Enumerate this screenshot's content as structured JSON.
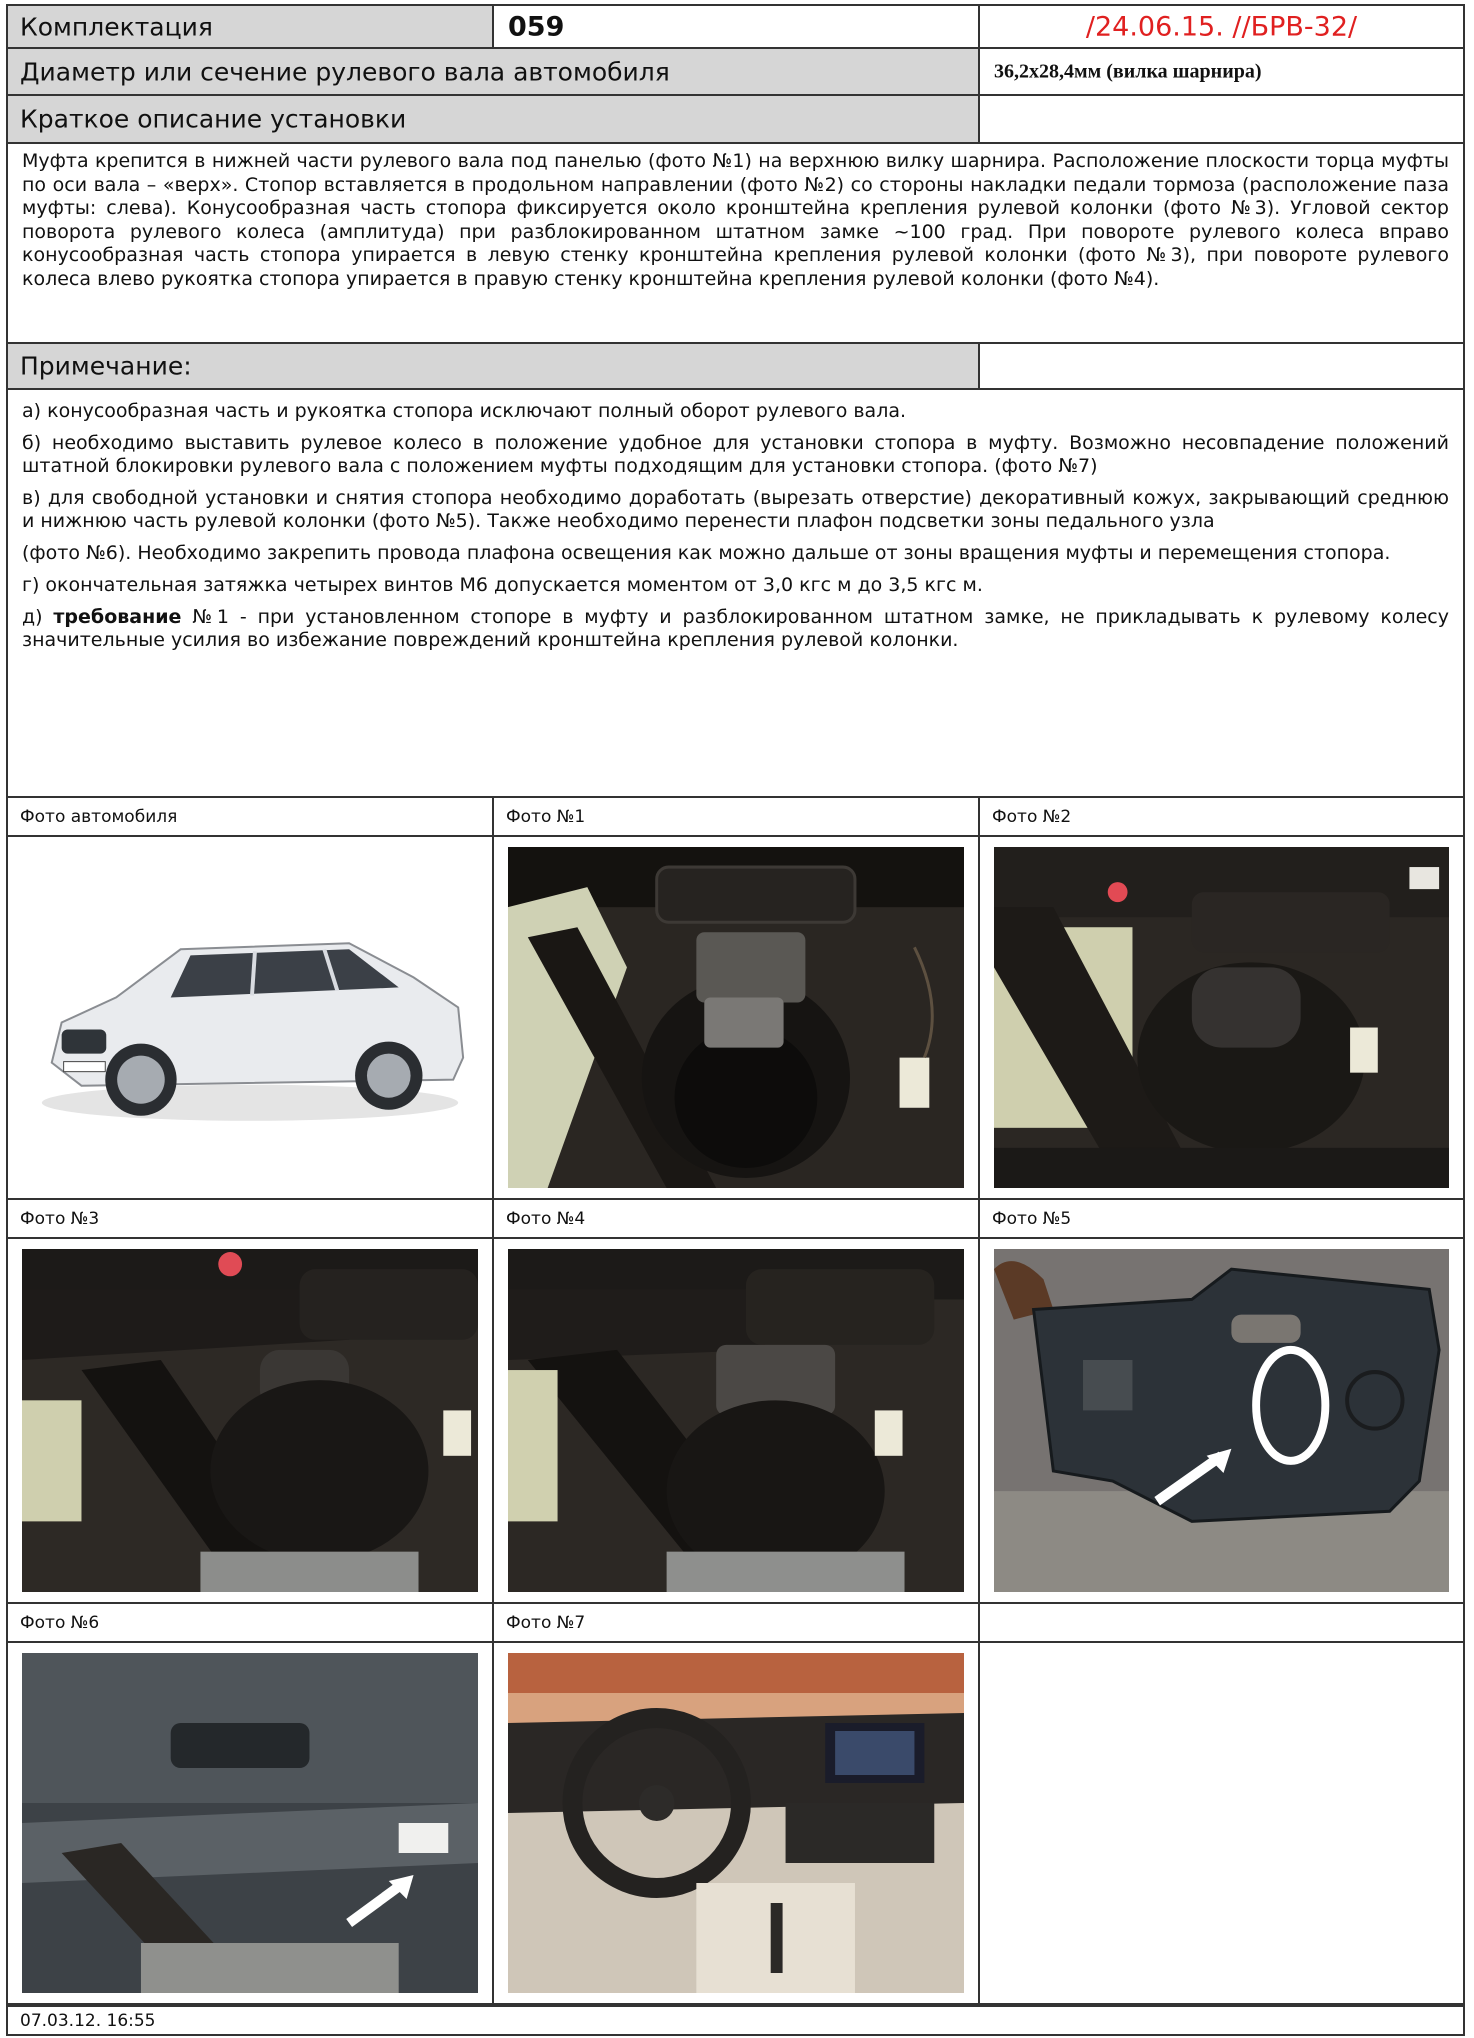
{
  "header": {
    "komplektaciya_label": "Комплектация",
    "komplektaciya_value": "059",
    "doc_code": "/24.06.15. //БРВ-32/",
    "shaft_label": "Диаметр или сечение рулевого вала автомобиля",
    "shaft_value": "36,2x28,4мм (вилка шарнира)",
    "install_label": "Краткое описание установки"
  },
  "description": "Муфта крепится в нижней части рулевого вала под панелью (фото №1) на верхнюю вилку шарнира. Расположение плоскости торца муфты по оси вала – «верх». Стопор вставляется в продольном направлении (фото №2) со стороны накладки педали тормоза (расположение паза муфты: слева). Конусообразная часть стопора фиксируется около кронштейна крепления рулевой колонки (фото №3). Угловой сектор поворота рулевого колеса (амплитуда) при разблокированном штатном замке ~100 град. При повороте рулевого колеса вправо конусообразная часть стопора упирается в левую стенку кронштейна крепления рулевой колонки (фото №3), при повороте рулевого колеса влево рукоятка стопора упирается в правую стенку кронштейна крепления рулевой колонки (фото №4).",
  "notes_label": "Примечание:",
  "notes": {
    "a": "а) конусообразная часть и рукоятка стопора исключают полный оборот рулевого вала.",
    "b": "б) необходимо выставить рулевое колесо в положение удобное для установки стопора в муфту. Возможно несовпадение положений штатной блокировки рулевого вала с положением муфты подходящим для установки стопора. (фото №7)",
    "v": "в) для свободной установки и снятия стопора необходимо доработать (вырезать отверстие) декоративный кожух, закрывающий среднюю и нижнюю часть рулевой колонки (фото №5). Также необходимо перенести плафон подсветки зоны педального узла",
    "v2": "(фото №6). Необходимо закрепить провода плафона освещения как можно дальше от зоны вращения муфты и перемещения стопора.",
    "g": "г) окончательная затяжка четырех винтов М6 допускается моментом от 3,0 кгс м до 3,5 кгс м.",
    "d_prefix": "д) ",
    "d_bold": "требование",
    "d_rest": " №1 - при установленном стопоре в муфту и разблокированном штатном замке, не прикладывать к рулевому колесу значительные усилия во избежание повреждений кронштейна крепления рулевой колонки."
  },
  "photos": {
    "car": "Фото автомобиля",
    "p1": "Фото №1",
    "p2": "Фото №2",
    "p3": "Фото №3",
    "p4": "Фото №4",
    "p5": "Фото №5",
    "p6": "Фото №6",
    "p7": "Фото №7"
  },
  "footer": "07.03.12.   16:55"
}
